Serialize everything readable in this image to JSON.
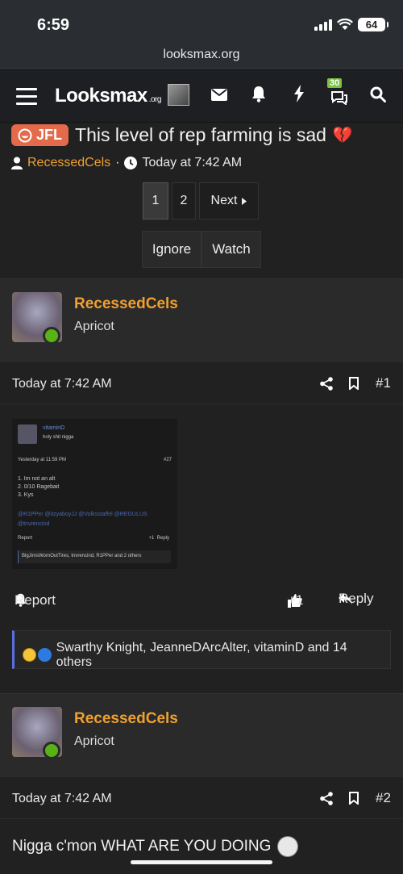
{
  "status": {
    "time": "6:59",
    "battery": "64"
  },
  "browser": {
    "url": "looksmax.org"
  },
  "nav": {
    "logo": "Looksmax",
    "logo_tld": ".org",
    "badge_count": "30"
  },
  "thread": {
    "prefix": "JFL",
    "title": "This level of rep farming is sad",
    "title_emoji": "💔",
    "author": "RecessedCels",
    "separator": "·",
    "date": "Today at 7:42 AM"
  },
  "pagination": {
    "pages": [
      "1",
      "2"
    ],
    "next_label": "Next"
  },
  "thread_actions": {
    "ignore": "Ignore",
    "watch": "Watch"
  },
  "posts": [
    {
      "username": "RecessedCels",
      "rank": "Apricot",
      "date": "Today at 7:42 AM",
      "number": "#1",
      "embedded_screenshot": {
        "username": "vitaminD",
        "text": "holy shit nigga",
        "date": "Yesterday at 11:59 PM",
        "number": "#27",
        "lines": [
          "1. Im not an alt",
          "2. 0/10 Ragebait",
          "3. Kys"
        ],
        "mentions": "@R1PPer  @itzyaboyJJ  @Volksstaffel  @REGULUS  @tnvrencind",
        "report": "Report",
        "plus": "+1",
        "reply": "Reply",
        "reactions": "BigJimsWornOutTires, tnvrencind, R1PPer and 2 others"
      },
      "report_label": "Report",
      "plus_label": "+1",
      "reply_label": "Reply",
      "reactions_text": "Swarthy Knight, JeanneDArcAlter, vitaminD and 14 others"
    },
    {
      "username": "RecessedCels",
      "rank": "Apricot",
      "date": "Today at 7:42 AM",
      "number": "#2",
      "text": "Nigga c'mon WHAT ARE YOU DOING"
    }
  ]
}
